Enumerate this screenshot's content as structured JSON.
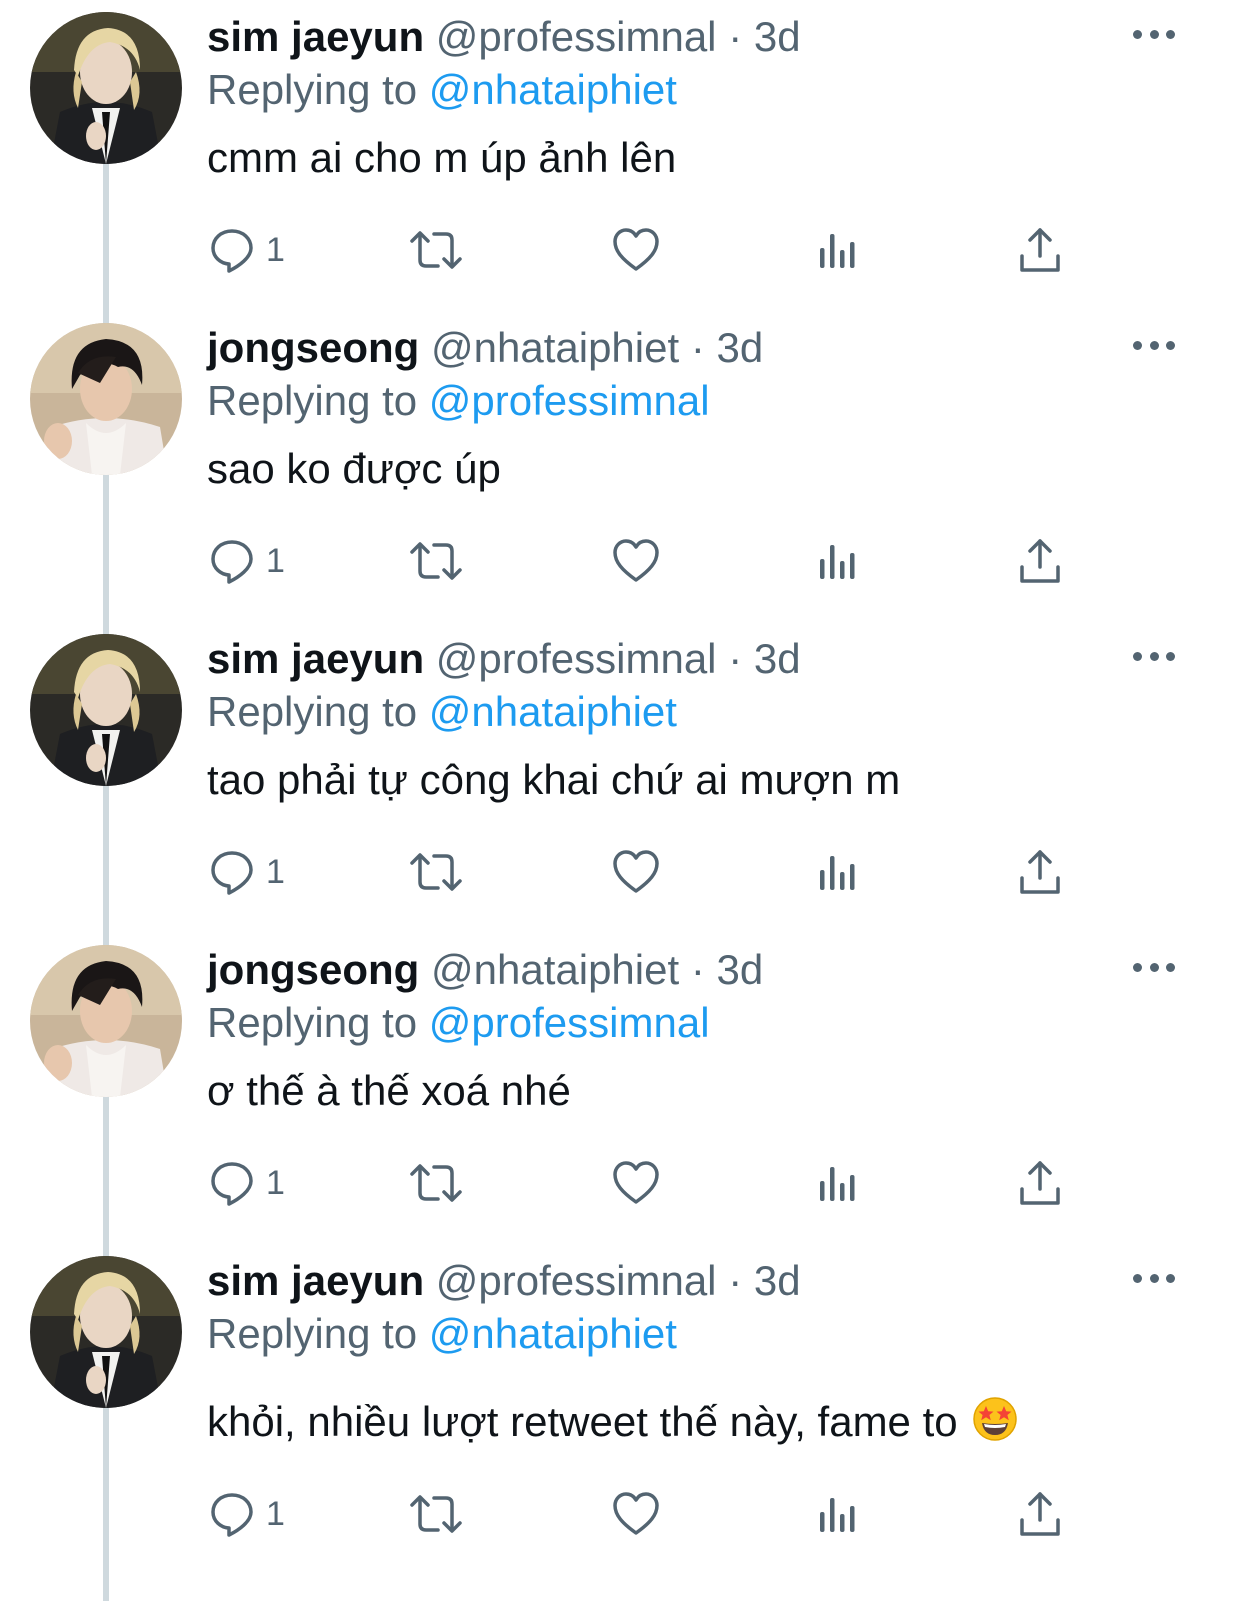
{
  "colors": {
    "text": "#0f1419",
    "secondary": "#536471",
    "link": "#1d9bf0",
    "thread_line": "#cfd9de"
  },
  "tweets": [
    {
      "name": "sim jaeyun",
      "handle": "@professimnal",
      "dot": "·",
      "time": "3d",
      "replying_prefix": "Replying to",
      "replying_to": "@nhataiphiet",
      "text": "cmm ai cho m úp ảnh lên",
      "reply_count": "1",
      "avatar": "avatar-blonde"
    },
    {
      "name": "jongseong",
      "handle": "@nhataiphiet",
      "dot": "·",
      "time": "3d",
      "replying_prefix": "Replying to",
      "replying_to": "@professimnal",
      "text": "sao ko được úp",
      "reply_count": "1",
      "avatar": "avatar-dark-hair"
    },
    {
      "name": "sim jaeyun",
      "handle": "@professimnal",
      "dot": "·",
      "time": "3d",
      "replying_prefix": "Replying to",
      "replying_to": "@nhataiphiet",
      "text": "tao phải tự công khai chứ ai mượn m",
      "reply_count": "1",
      "avatar": "avatar-blonde"
    },
    {
      "name": "jongseong",
      "handle": "@nhataiphiet",
      "dot": "·",
      "time": "3d",
      "replying_prefix": "Replying to",
      "replying_to": "@professimnal",
      "text": "ơ thế à thế xoá nhé",
      "reply_count": "1",
      "avatar": "avatar-dark-hair"
    },
    {
      "name": "sim jaeyun",
      "handle": "@professimnal",
      "dot": "·",
      "time": "3d",
      "replying_prefix": "Replying to",
      "replying_to": "@nhataiphiet",
      "text": "khỏi, nhiều lượt retweet thế này, fame to",
      "emoji": "star-struck-emoji",
      "reply_count": "1",
      "avatar": "avatar-blonde"
    }
  ]
}
